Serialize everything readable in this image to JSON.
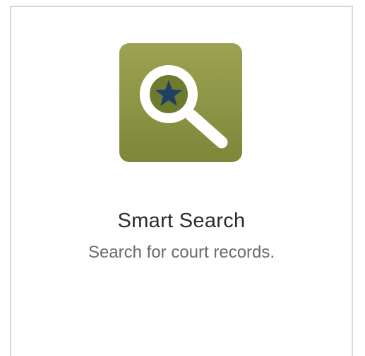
{
  "tile": {
    "icon": "search-star-icon",
    "title": "Smart Search",
    "subtitle": "Search for court records."
  },
  "colors": {
    "icon_background": "#8a9343",
    "star": "#1e3f66",
    "border": "#d7d7d7"
  }
}
